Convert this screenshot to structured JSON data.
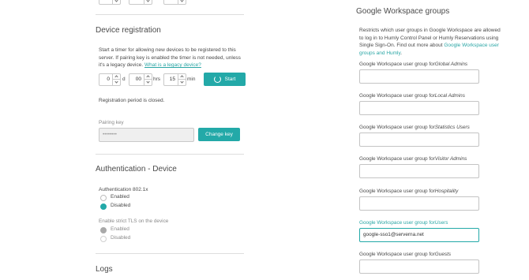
{
  "top_spinners": [
    "",
    "",
    ""
  ],
  "device_registration": {
    "title": "Device registration",
    "description_prefix": "Start a timer for allowing new devices to be registered to this server. If pairing key is enabled the timer is not needed, unless it's a legacy device. ",
    "description_link": "What is a legacy device?",
    "days_value": "0",
    "days_unit": "d",
    "hours_value": "00",
    "hours_unit": "hrs",
    "minutes_value": "15",
    "minutes_unit": "min",
    "start_label": "Start",
    "status_text": "Registration period is closed.",
    "pairing_key_label": "Pairing key",
    "pairing_key_value": "••••••••",
    "change_key_label": "Change key"
  },
  "authentication_device": {
    "title": "Authentication - Device",
    "auth_8021x_label": "Authentication 802.1x",
    "auth_8021x_options": [
      "Enabled",
      "Disabled"
    ],
    "auth_8021x_selected": "Disabled",
    "strict_tls_label": "Enable strict TLS on the device",
    "strict_tls_options": [
      "Enabled",
      "Disabled"
    ],
    "strict_tls_selected": "Enabled"
  },
  "logs": {
    "title": "Logs"
  },
  "google_workspace": {
    "title": "Google Workspace groups",
    "description_prefix": "Restricts which user groups in Google Workspace are allowed to log in to Humly Control Panel or Humly Reservations using Single Sign-On. Find out more about ",
    "description_link": "Google Workspace user groups and Humly",
    "description_suffix": ".",
    "label_prefix": "Google Workspace user group for",
    "groups": [
      {
        "role": "Global Admins",
        "value": ""
      },
      {
        "role": "Local Admins",
        "value": ""
      },
      {
        "role": "Statistics Users",
        "value": ""
      },
      {
        "role": "Visitor Admins",
        "value": ""
      },
      {
        "role": "Hospitality",
        "value": ""
      },
      {
        "role": "Users",
        "value": "google-sso1@serverna.net"
      },
      {
        "role": "Guests",
        "value": ""
      }
    ],
    "active_group": "Users"
  },
  "colors": {
    "accent": "#23a9a8",
    "link": "#2aa6a5",
    "text": "#4a4a4a",
    "muted": "#8a8a8a"
  },
  "icons": {
    "start_button_icon": "timer-icon",
    "spinner_up_icon": "chevron-up-icon",
    "spinner_down_icon": "chevron-down-icon"
  }
}
